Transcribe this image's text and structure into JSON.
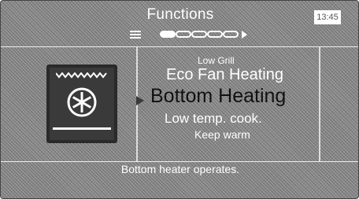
{
  "header": {
    "title": "Functions",
    "clock": "13:45"
  },
  "pager": {
    "page_count": 5,
    "active_page": 1
  },
  "function_tile": {
    "icon": "bottom-heating-fan-icon"
  },
  "function_list": {
    "items": [
      "Low Grill",
      "Eco Fan Heating",
      "Bottom Heating",
      "Low temp. cook.",
      "Keep warm"
    ],
    "selected_index": 2
  },
  "footer": {
    "description": "Bottom heater operates."
  },
  "colors": {
    "text": "#ffffff",
    "selected_text": "#111111",
    "tile": "#2a2a2a"
  }
}
